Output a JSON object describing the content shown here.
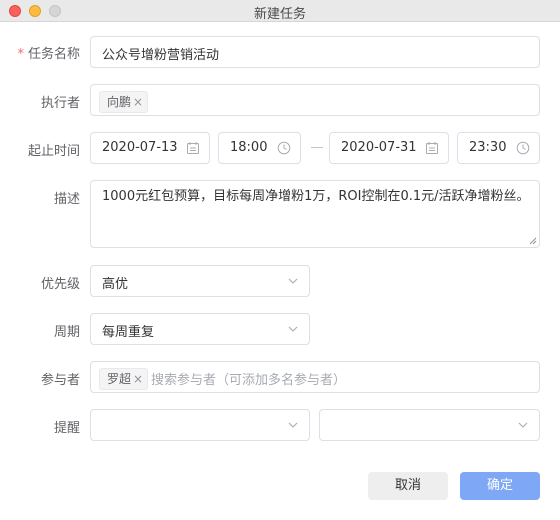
{
  "window": {
    "title": "新建任务"
  },
  "form": {
    "name": {
      "label": "任务名称",
      "required_mark": "*",
      "value": "公众号增粉营销活动"
    },
    "assignee": {
      "label": "执行者",
      "tags": [
        "向鹏"
      ]
    },
    "time": {
      "label": "起止时间",
      "start_date": "2020-07-13",
      "start_time": "18:00",
      "end_date": "2020-07-31",
      "end_time": "23:30"
    },
    "description": {
      "label": "描述",
      "value": "1000元红包预算，目标每周净增粉1万，ROI控制在0.1元/活跃净增粉丝。"
    },
    "priority": {
      "label": "优先级",
      "value": "高优"
    },
    "cycle": {
      "label": "周期",
      "value": "每周重复"
    },
    "participants": {
      "label": "参与者",
      "tags": [
        "罗超"
      ],
      "placeholder": "搜索参与者（可添加多名参与者）"
    },
    "reminder": {
      "label": "提醒",
      "value_1": "",
      "value_2": ""
    }
  },
  "buttons": {
    "cancel": "取消",
    "ok": "确定"
  },
  "icons": {
    "tag_remove": "×"
  },
  "colors": {
    "primary_button": "#7ea8f6",
    "required": "#f56c6c"
  }
}
